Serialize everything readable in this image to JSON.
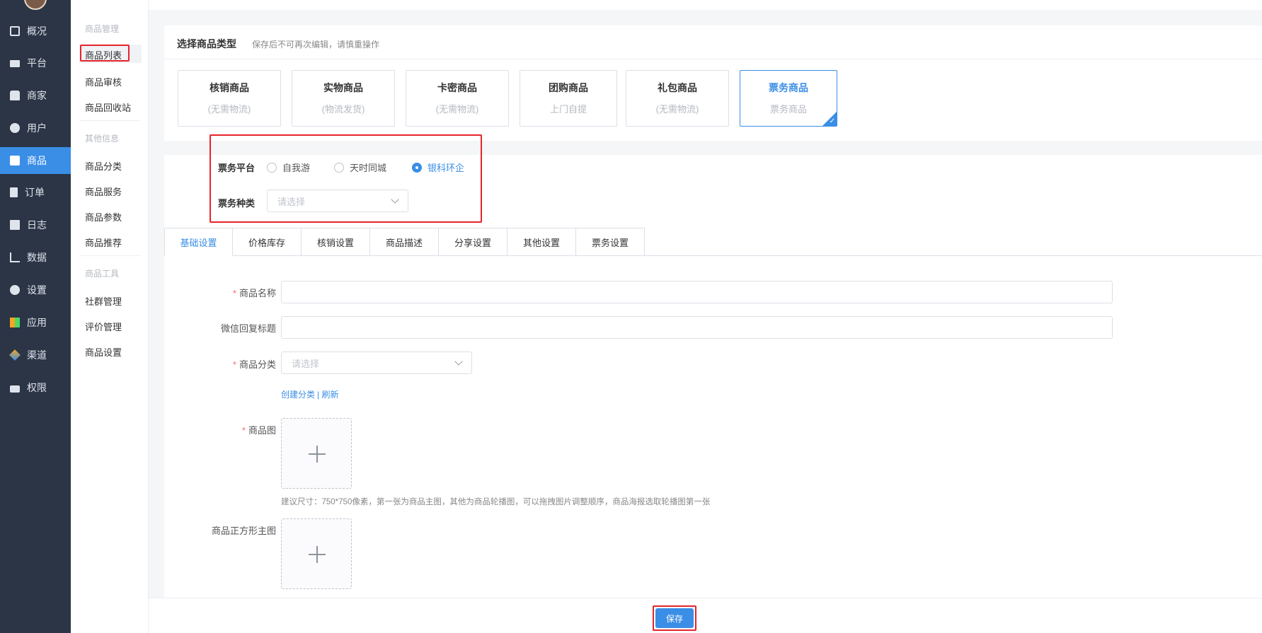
{
  "nav": {
    "items": [
      {
        "label": "概况",
        "icon": "dashboard-icon"
      },
      {
        "label": "平台",
        "icon": "monitor-icon"
      },
      {
        "label": "商家",
        "icon": "shop-icon"
      },
      {
        "label": "用户",
        "icon": "user-icon"
      },
      {
        "label": "商品",
        "icon": "shopping-bag-icon",
        "active": true
      },
      {
        "label": "订单",
        "icon": "clipboard-icon"
      },
      {
        "label": "日志",
        "icon": "book-icon"
      },
      {
        "label": "数据",
        "icon": "bar-chart-icon"
      },
      {
        "label": "设置",
        "icon": "gear-icon"
      },
      {
        "label": "应用",
        "icon": "apps-grid-icon"
      },
      {
        "label": "渠道",
        "icon": "cube-icon"
      },
      {
        "label": "权限",
        "icon": "lock-icon"
      }
    ]
  },
  "subnav": {
    "group1": "商品管理",
    "list": "商品列表",
    "review": "商品审核",
    "recycle": "商品回收站",
    "group2": "其他信息",
    "category": "商品分类",
    "service": "商品服务",
    "params": "商品参数",
    "recommend": "商品推荐",
    "group3": "商品工具",
    "community": "社群管理",
    "comments": "评价管理",
    "settings": "商品设置"
  },
  "type_section": {
    "title": "选择商品类型",
    "hint": "保存后不可再次编辑，请慎重操作",
    "types": [
      {
        "name": "核销商品",
        "sub": "(无需物流)"
      },
      {
        "name": "实物商品",
        "sub": "(物流发货)"
      },
      {
        "name": "卡密商品",
        "sub": "(无需物流)"
      },
      {
        "name": "团购商品",
        "sub": "上门自提"
      },
      {
        "name": "礼包商品",
        "sub": "(无需物流)"
      },
      {
        "name": "票务商品",
        "sub": "票务商品",
        "selected": true
      }
    ]
  },
  "ticket": {
    "platform_label": "票务平台",
    "options": [
      "自我游",
      "天时同城",
      "银科环企"
    ],
    "selected": "银科环企",
    "kind_label": "票务种类",
    "kind_placeholder": "请选择"
  },
  "tabs": [
    "基础设置",
    "价格库存",
    "核销设置",
    "商品描述",
    "分享设置",
    "其他设置",
    "票务设置"
  ],
  "form": {
    "name_label": "商品名称",
    "wechat_title_label": "微信回复标题",
    "category_label": "商品分类",
    "category_placeholder": "请选择",
    "create_category": "创建分类",
    "refresh": "| 刷新",
    "image_label": "商品图",
    "image_tip": "建议尺寸：750*750像素，第一张为商品主图，其他为商品轮播图，可以拖拽图片调整顺序，商品海报选取轮播图第一张",
    "square_image_label": "商品正方形主图"
  },
  "footer": {
    "save": "保存"
  },
  "colors": {
    "accent": "#3a8ee6",
    "nav_bg": "#2b3546",
    "highlight": "#e5242b"
  }
}
